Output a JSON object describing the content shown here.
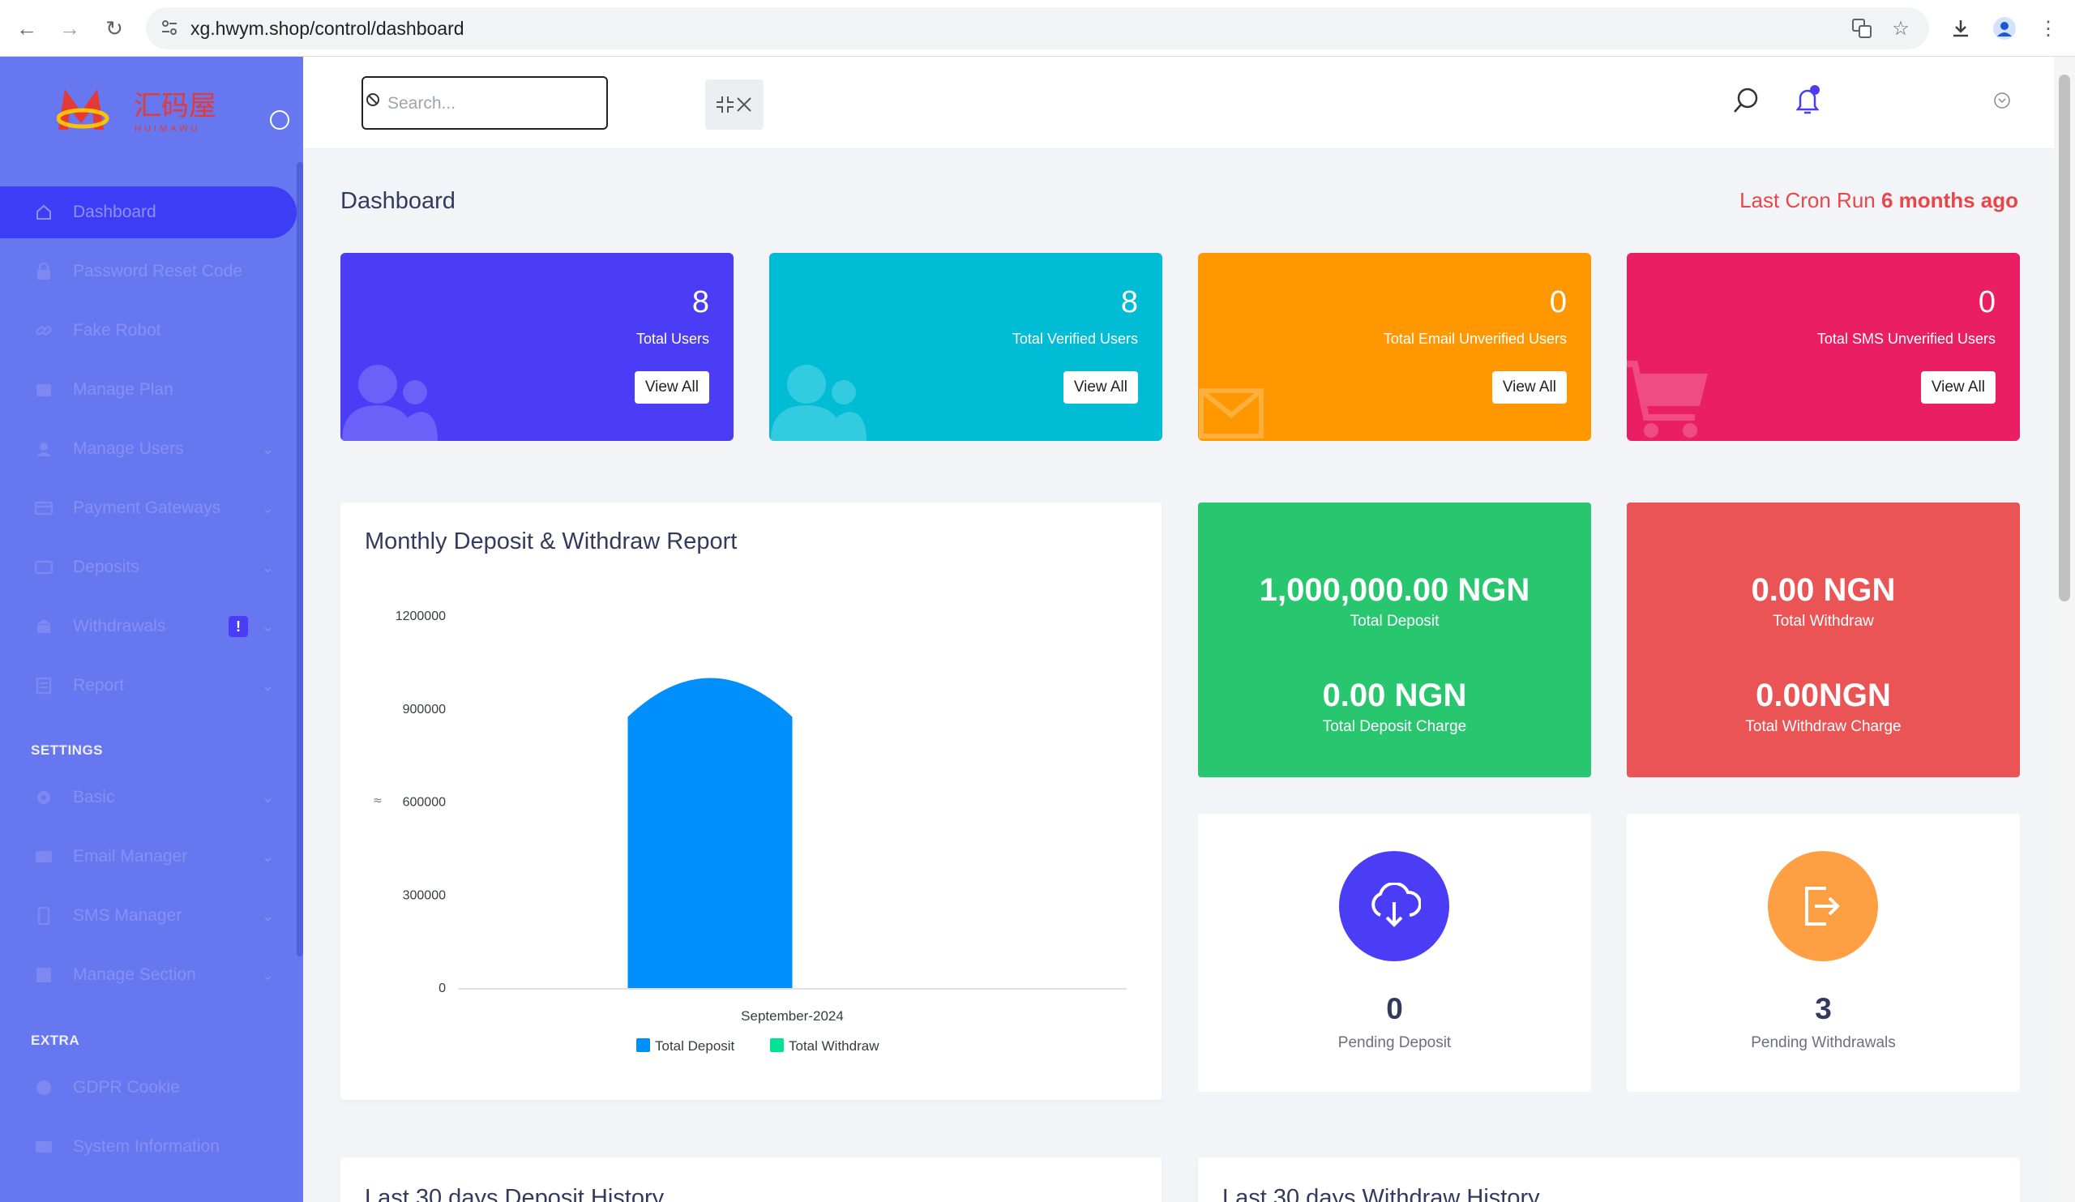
{
  "browser": {
    "url": "xg.hwym.shop/control/dashboard"
  },
  "topbar": {
    "search_placeholder": "Search..."
  },
  "sidebar": {
    "items": [
      {
        "label": "Dashboard"
      },
      {
        "label": "Password Reset Code"
      },
      {
        "label": "Fake Robot"
      },
      {
        "label": "Manage Plan"
      },
      {
        "label": "Manage Users"
      },
      {
        "label": "Payment Gateways"
      },
      {
        "label": "Deposits"
      },
      {
        "label": "Withdrawals",
        "badge": "!"
      },
      {
        "label": "Report"
      }
    ],
    "settings_heading": "SETTINGS",
    "settings_items": [
      {
        "label": "Basic"
      },
      {
        "label": "Email Manager"
      },
      {
        "label": "SMS Manager"
      },
      {
        "label": "Manage Section"
      }
    ],
    "extra_heading": "EXTRA",
    "extra_items": [
      {
        "label": "GDPR Cookie"
      },
      {
        "label": "System Information"
      }
    ]
  },
  "page": {
    "title": "Dashboard",
    "cron_label": "Last Cron Run",
    "cron_value": "6 months ago"
  },
  "stats": [
    {
      "value": "8",
      "label": "Total Users",
      "button": "View All",
      "color": "#4a3df5"
    },
    {
      "value": "8",
      "label": "Total Verified Users",
      "button": "View All",
      "color": "#00bcd4"
    },
    {
      "value": "0",
      "label": "Total Email Unverified Users",
      "button": "View All",
      "color": "#ff9800"
    },
    {
      "value": "0",
      "label": "Total SMS Unverified Users",
      "button": "View All",
      "color": "#e91e63"
    }
  ],
  "money": {
    "deposit": {
      "value": "1,000,000.00 NGN",
      "label": "Total Deposit",
      "charge_value": "0.00 NGN",
      "charge_label": "Total Deposit Charge",
      "color": "#28c76f"
    },
    "withdraw": {
      "value": "0.00 NGN",
      "label": "Total Withdraw",
      "charge_value": "0.00NGN",
      "charge_label": "Total Withdraw Charge",
      "color": "#ea5455"
    }
  },
  "pending": {
    "deposit": {
      "count": "0",
      "label": "Pending Deposit",
      "color": "#4a3df5"
    },
    "withdraw": {
      "count": "3",
      "label": "Pending Withdrawals",
      "color": "#ff9f43"
    }
  },
  "history": {
    "deposit_title": "Last 30 days Deposit History",
    "withdraw_title": "Last 30 days Withdraw History"
  },
  "chart_data": {
    "type": "bar",
    "title": "Monthly Deposit & Withdraw Report",
    "categories": [
      "September-2024"
    ],
    "series": [
      {
        "name": "Total Deposit",
        "values": [
          1000000
        ],
        "color": "#008ffb"
      },
      {
        "name": "Total Withdraw",
        "values": [
          0
        ],
        "color": "#00e396"
      }
    ],
    "y_ticks": [
      "1200000",
      "900000",
      "600000",
      "300000",
      "0"
    ],
    "ylim": [
      0,
      1200000
    ],
    "legend": "bottom",
    "grid": false
  }
}
